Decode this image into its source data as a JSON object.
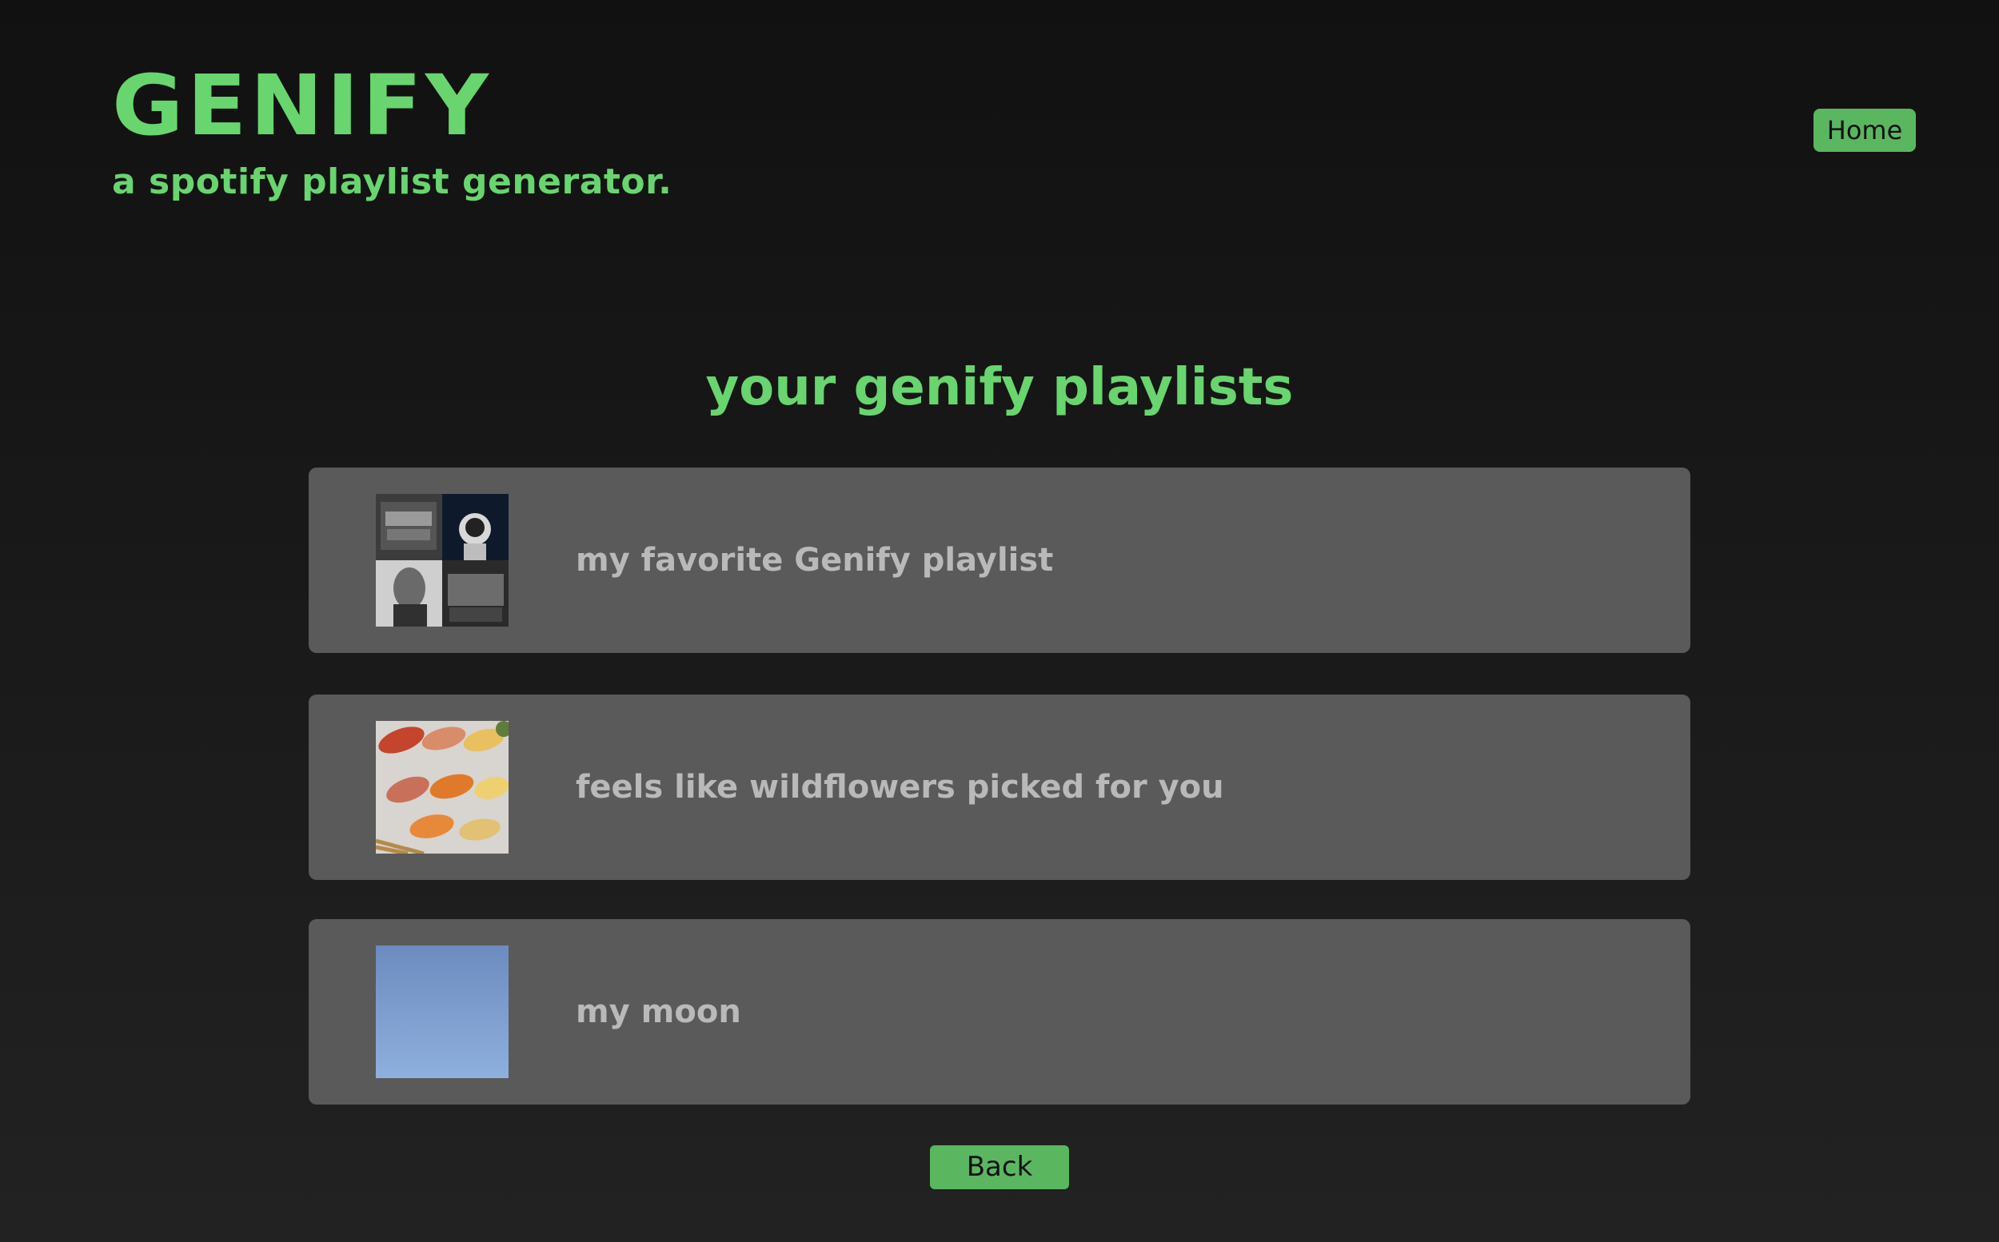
{
  "header": {
    "logo": "GENIFY",
    "tagline": "a spotify playlist generator.",
    "home_label": "Home"
  },
  "main": {
    "title": "your genify playlists",
    "playlists": [
      {
        "name": "my favorite Genify playlist",
        "cover": "collage-cover"
      },
      {
        "name": "feels like wildflowers picked for you",
        "cover": "sushi-cover"
      },
      {
        "name": "my moon",
        "cover": "moon-sky-cover"
      }
    ],
    "back_label": "Back"
  },
  "colors": {
    "accent": "#68d56e",
    "button": "#5bb660",
    "card": "#5a5a5a",
    "card_text": "#b9b9b9"
  }
}
